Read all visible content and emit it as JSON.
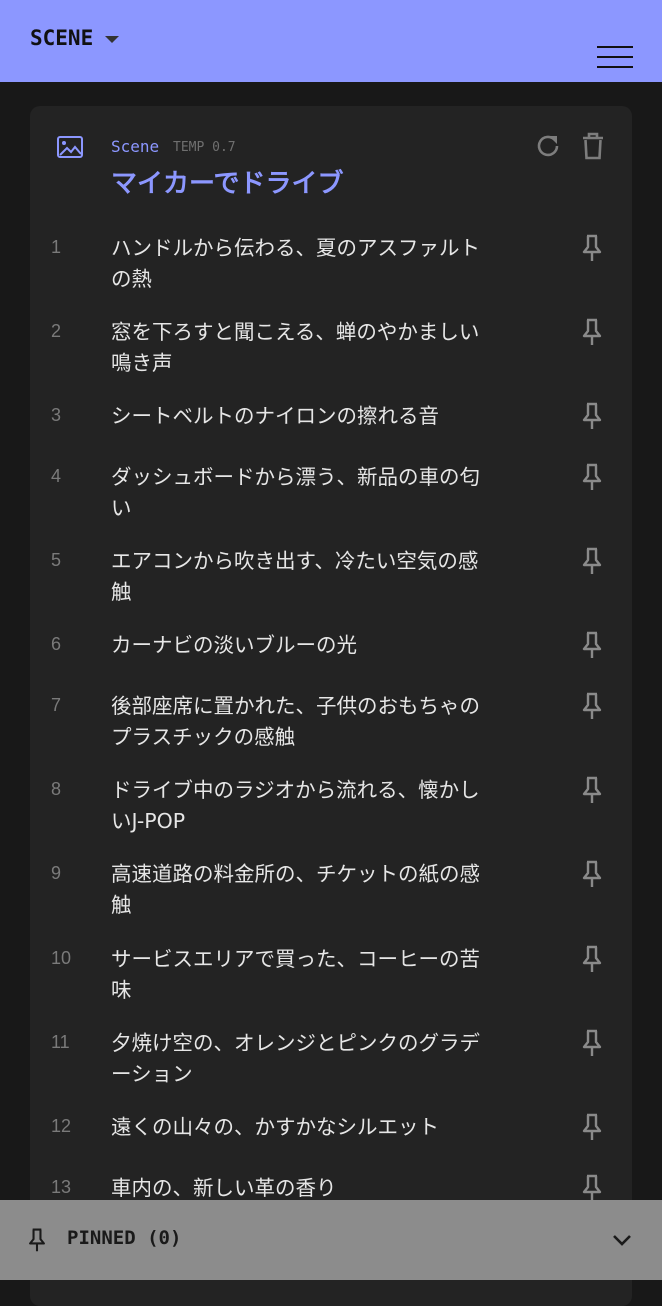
{
  "header": {
    "title": "SCENE"
  },
  "scene": {
    "kind": "Scene",
    "temp": "TEMP 0.7",
    "title": "マイカーでドライブ"
  },
  "items": [
    {
      "num": "1",
      "text": "ハンドルから伝わる、夏のアスファルトの熱"
    },
    {
      "num": "2",
      "text": "窓を下ろすと聞こえる、蝉のやかましい鳴き声"
    },
    {
      "num": "3",
      "text": "シートベルトのナイロンの擦れる音"
    },
    {
      "num": "4",
      "text": "ダッシュボードから漂う、新品の車の匂い"
    },
    {
      "num": "5",
      "text": "エアコンから吹き出す、冷たい空気の感触"
    },
    {
      "num": "6",
      "text": "カーナビの淡いブルーの光"
    },
    {
      "num": "7",
      "text": "後部座席に置かれた、子供のおもちゃのプラスチックの感触"
    },
    {
      "num": "8",
      "text": "ドライブ中のラジオから流れる、懐かしいJ-POP"
    },
    {
      "num": "9",
      "text": "高速道路の料金所の、チケットの紙の感触"
    },
    {
      "num": "10",
      "text": "サービスエリアで買った、コーヒーの苦味"
    },
    {
      "num": "11",
      "text": "夕焼け空の、オレンジとピンクのグラデーション"
    },
    {
      "num": "12",
      "text": "遠くの山々の、かすかなシルエット"
    },
    {
      "num": "13",
      "text": "車内の、新しい革の香り"
    }
  ],
  "pinned": {
    "label": "PINNED (0)"
  },
  "colors": {
    "accent": "#8c97ff",
    "background": "#181818",
    "card": "#232323",
    "footer": "#8c8c8c"
  }
}
